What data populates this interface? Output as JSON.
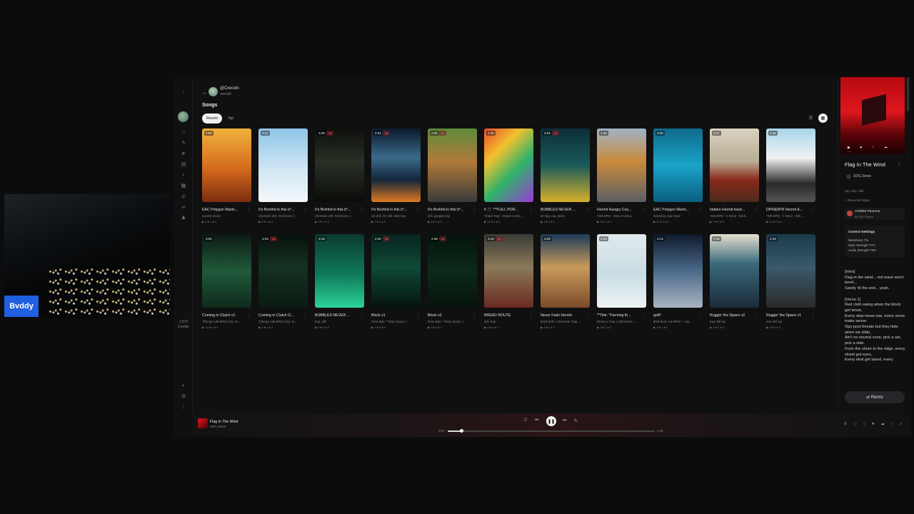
{
  "webcam": {
    "name": "Bvddy"
  },
  "sidebar": {
    "credits_value": "1,570",
    "credits_label": "Credits"
  },
  "profile": {
    "display_name": "@Crecoin",
    "handle": "crecoin"
  },
  "section": {
    "title": "Songs",
    "tabs": [
      "Recent",
      "Top"
    ]
  },
  "songs": [
    {
      "dur": "2:59",
      "ver": "",
      "title": "EAC Polygon Warlo...",
      "tags": "country music",
      "stats": "▶ 4 ♥ 1 ● 0",
      "art": "linear-gradient(180deg,#f0b23c 0%,#d46a1c 55%,#7a2e10 100%)"
    },
    {
      "dur": "3:22",
      "ver": "",
      "title": "It's Brehhd in this b*...",
      "tags": "cinematic drill, horrorcore, f...",
      "stats": "▶ 5 ♥ 1 ● 0",
      "art": "linear-gradient(180deg,#8fc5e8 0%,#cfe6f3 55%,#f4f8fb 100%)"
    },
    {
      "dur": "3:29",
      "ver": "v5",
      "title": "It's Brehhd in this b*...",
      "tags": "cinematic drill, horrorcore, t...",
      "stats": "▶ 4 ♥ 1 ● 0",
      "art": "linear-gradient(180deg,#0d0f0c 0%,#2a3026 45%,#0b0c0a 100%)"
    },
    {
      "dur": "2:24",
      "ver": "v5",
      "title": "It's Brehhd in this b*...",
      "tags": "UK drill, NY drill, dark trap",
      "stats": "▶ 7 ♥ 1 ● 0",
      "art": "linear-gradient(180deg,#0b1a2c 0%,#3b6a8a 40%,#13263a 70%,#e07a20 100%)"
    },
    {
      "dur": "2:05",
      "ver": "v4",
      "title": "It's Brehhd in this b*...",
      "tags": "drill, gangsta rap",
      "stats": "▶ 8 ♥ 1 ● 0",
      "art": "linear-gradient(180deg,#5e8a3c 0%,#b07a3a 45%,#3a3a3a 100%)"
    },
    {
      "dur": "2:35",
      "ver": "",
      "title": "# 🎵 ***FULL POR...",
      "tags": "*[Hard Trap + Degen Come...",
      "stats": "▶ 10 ♥ 1 ● 0",
      "art": "linear-gradient(135deg,#e84a2a 0%,#f2c12e 30%,#2fb36b 60%,#9a3ad6 100%)"
    },
    {
      "dur": "3:04",
      "ver": "v5",
      "title": "BUBBLES NEVER ...",
      "tags": "uk trap, rap, grime",
      "stats": "▶ 3 ♥ 1 ● 0",
      "art": "linear-gradient(180deg,#0e2e3a 0%,#1a5a5a 50%,#d6b02a 100%)"
    },
    {
      "dur": "4:48",
      "ver": "",
      "title": "Hermit Hungry Cos...",
      "tags": "*038 BPM · Drop A tuning...",
      "stats": "▶ 2 ♥ 1 ● 0",
      "art": "linear-gradient(180deg,#9fb3c4 0%,#c98a3a 45%,#5b5f63 100%)"
    },
    {
      "dur": "3:09",
      "ver": "",
      "title": "EAC Polygon Warlo...",
      "tags": "industrial, trap metal",
      "stats": "▶ 11 ♥ 0 ● 0",
      "art": "linear-gradient(180deg,#0f6a8a 0%,#1aa3c8 50%,#0a5f7f 100%)"
    },
    {
      "dur": "3:27",
      "ver": "",
      "title": "hidden Hermit track...",
      "tags": "*036 BPM · C minor · Dark...",
      "stats": "▶ 7 ♥ 0 ● 0",
      "art": "linear-gradient(180deg,#d9d2c0 0%,#b8ad95 45%,#8a2a1a 70%,#4a2a1c 100%)"
    },
    {
      "dur": "2:45",
      "ver": "",
      "title": "DPR&DPR Hermit A...",
      "tags": "*040 BPM · C minor · Drill ...",
      "stats": "▶ 14 ♥ 0 ● 0",
      "art": "linear-gradient(180deg,#a7d6ea 0%,#f2f2f2 40%,#2a2a2a 75%,#555 100%)"
    },
    {
      "dur": "3:02",
      "ver": "",
      "title": "Coming in Clutch v1",
      "tags": "*[Tempo 138 BPM | Key: D...",
      "stats": "▶ 10 ♥ 0 ● 0",
      "art": "linear-gradient(180deg,#0c1a14 0%,#1f5a3a 50%,#0f2a1c 100%)"
    },
    {
      "dur": "2:34",
      "ver": "v5",
      "title": "Coming in Clutch O...",
      "tags": "*[Tempo 138 BPM | Key: D...",
      "stats": "▶ 8 ♥ 0 ● 0",
      "art": "linear-gradient(180deg,#07110c 0%,#143222 45%,#0a1a12 100%)"
    },
    {
      "dur": "3:19",
      "ver": "",
      "title": "BUBBLES NEVER ...",
      "tags": "trap, drill",
      "stats": "▶ 6 ♥ 0 ● 0",
      "art": "linear-gradient(180deg,#0b3a30 0%,#0f7a5a 55%,#2cd39a 100%)"
    },
    {
      "dur": "2:30",
      "ver": "v5",
      "title": "Block v1",
      "tags": "Flow style: **slow, heavy, c...",
      "stats": "▶ 4 ♥ 0 ● 0",
      "art": "linear-gradient(180deg,#08241e 0%,#0f4a38 45%,#06130f 100%)"
    },
    {
      "dur": "2:39",
      "ver": "v4",
      "title": "Block v2",
      "tags": "Flow style: **slow, heavy, c...",
      "stats": "▶ 3 ♥ 0 ● 0",
      "art": "linear-gradient(180deg,#06140d 0%,#0c2a1a 50%,#06120b 100%)"
    },
    {
      "dur": "3:15",
      "ver": "v4",
      "title": "BREAD ROUTE",
      "tags": "drill, trap",
      "stats": "▶ 4 ♥ 0 ● 0",
      "art": "linear-gradient(180deg,#3a3a36 0%,#8a7a5a 45%,#6a2a20 100%)"
    },
    {
      "dur": "3:29",
      "ver": "",
      "title": "Never Fade Hermit",
      "tags": "[Dark Drill + Cinematic Trap ...",
      "stats": "▶ 3 ♥ 0 ● 0",
      "art": "linear-gradient(180deg,#1c3a5a 0%,#c99a5a 45%,#7a4a2a 100%)"
    },
    {
      "dur": "2:34",
      "ver": "",
      "title": "**Title: \"Farming th...",
      "tags": "[Grime x Trap x Drill fusion –...",
      "stats": "▶ 3 ♥ 1 ● 0",
      "art": "linear-gradient(180deg,#dfe9ec 0%,#c9dde4 55%,#eef3f4 100%)"
    },
    {
      "dur": "2:14",
      "ver": "",
      "title": "getP",
      "tags": "[Drill Beat: 140 BPM — dar...",
      "stats": "▶ 3 ♥ 1 ● 0",
      "art": "linear-gradient(180deg,#0e1a2a 0%,#4a6a8a 50%,#a9b4c2 100%)"
    },
    {
      "dur": "2:43",
      "ver": "",
      "title": "Ruggin' the Space v2",
      "tags": "trap drill rap",
      "stats": "▶ 4 ♥ 0 ● 0",
      "art": "linear-gradient(180deg,#e5dfcf 0%,#3a6a7a 40%,#1a2a3a 100%)"
    },
    {
      "dur": "2:19",
      "ver": "",
      "title": "Ruggin' the Space v1",
      "tags": "trap drill rap",
      "stats": "▶ 5 ♥ 0 ● 0",
      "art": "linear-gradient(180deg,#1a3a4a 0%,#3a5a6a 45%,#2a2a2a 100%)"
    }
  ],
  "now_playing": {
    "title": "Flag In The Wind",
    "artist": "SDG.Steve",
    "tags": "rap, trap, drill",
    "show_full": "+ Show full styles",
    "persona_name": "Untitled Persona",
    "persona_by": "By SDG.Steve",
    "controls_heading": "Control Settings",
    "weirdness": "Weirdness 7%",
    "style_strength": "Style Strength 77%",
    "audio_strength": "Audio Strength 70%",
    "remix_label": "⇄ Remix",
    "lyrics": [
      "[Intro]",
      "Flag in the wind... red wave won't bend...",
      "Sandy 'til the end... yeah.",
      "",
      "[Verse 1]",
      "Red cloth swing when the block get tense,",
      "Every step mean war, every move make sense.",
      "Ops post threats but they hide when we slide,",
      "Ain't no neutral zone, pick a set, pick a side.",
      "From the shore to the ridge, every street got eyes,",
      "Every deal get taxed, every"
    ]
  },
  "player": {
    "title": "Flag In The Wind",
    "artist": "SDG.Steve",
    "elapsed": "0:07",
    "total": "2:05",
    "progress": 0.065
  },
  "colors": {
    "accent": "#e0161e",
    "bg": "#101011"
  }
}
